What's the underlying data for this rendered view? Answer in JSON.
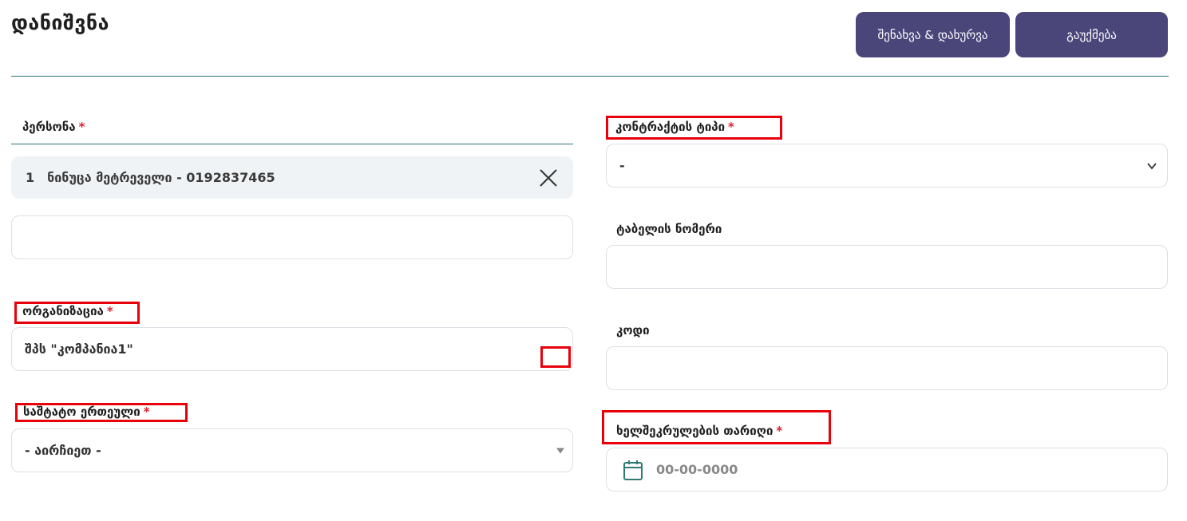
{
  "header": {
    "title": "დანიშვნა",
    "save_label": "შენახვა & დახურვა",
    "cancel_label": "გაუქმება"
  },
  "person": {
    "label": "პერსონა",
    "required_mark": "*",
    "selected_index": "1",
    "selected_text": "ნინუცა მეტრეველი - 0192837465",
    "extra_value": ""
  },
  "organization": {
    "label": "ორგანიზაცია",
    "required_mark": "*",
    "value": "შპს \"კომპანია1\""
  },
  "staff_unit": {
    "label": "საშტატო ერთეული",
    "required_mark": "*",
    "value": "- აირჩიეთ -"
  },
  "contract_type": {
    "label": "კონტრაქტის ტიპი",
    "required_mark": "*",
    "value": "-"
  },
  "table_number": {
    "label": "ტაბელის ნომერი",
    "value": ""
  },
  "code": {
    "label": "კოდი",
    "value": ""
  },
  "signing_date": {
    "label": "ხელშეკრულების თარიღი",
    "required_mark": "*",
    "placeholder": "00-00-0000"
  },
  "colors": {
    "button_bg": "#4a467a",
    "accent_line": "#2f6f7a",
    "required": "#e0202a",
    "highlight": "#e8000b",
    "calendar_icon": "#2f7a72"
  }
}
